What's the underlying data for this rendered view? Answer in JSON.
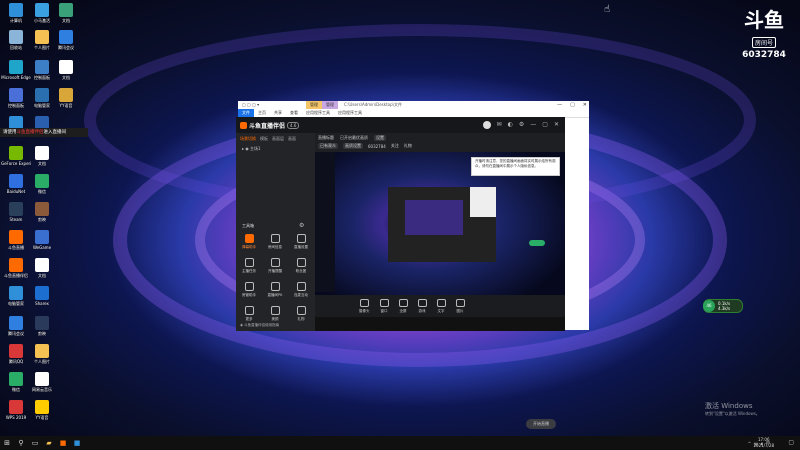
{
  "desktop": {
    "icons": [
      {
        "label": "计算机",
        "color": "#2f8fd8"
      },
      {
        "label": "小马激活",
        "color": "#3aa0e0"
      },
      {
        "label": "Microsoft Edge",
        "color": "#1fa5c9"
      },
      {
        "label": "回收站",
        "color": "#8ab4d8"
      },
      {
        "label": "控制面板",
        "color": "#3d7fc7"
      },
      {
        "label": "GeForce Experience",
        "color": "#76b900"
      },
      {
        "label": "BaiduNet",
        "color": "#2f6fe0"
      },
      {
        "label": "Steam",
        "color": "#2a3f5a"
      },
      {
        "label": "斗鱼直播",
        "color": "#ff6a00"
      },
      {
        "label": "斗鱼直播伴侣",
        "color": "#ff6a00"
      },
      {
        "label": "电脑管家",
        "color": "#2f8fd8"
      },
      {
        "label": "WeGame",
        "color": "#3a6fd0"
      },
      {
        "label": "腾讯QQ",
        "color": "#d93838"
      },
      {
        "label": "微信",
        "color": "#2aae67"
      },
      {
        "label": "WPS 2019",
        "color": "#d93838"
      },
      {
        "label": "YY语音",
        "color": "#ffcc00"
      },
      {
        "label": "剪映",
        "color": "#222222"
      },
      {
        "label": "Sharex",
        "color": "#1c6fd1"
      },
      {
        "label": "腾讯会议",
        "color": "#2f7fe0"
      },
      {
        "label": "个人图片",
        "color": "#f4c152"
      },
      {
        "label": "网易云音乐",
        "color": "#d33a31"
      },
      {
        "label": "文档",
        "color": "#ffffff"
      }
    ],
    "popup": {
      "prefix": "请使用",
      "highlight": "斗鱼直播伴侣",
      "suffix": "进入直播间"
    }
  },
  "room_logo": {
    "mark": "斗鱼",
    "tag": "房间号",
    "room_number": "6032784"
  },
  "explorer": {
    "tabs": [
      "管理",
      "管理"
    ],
    "path": "C:\\Users\\Admin\\Desktop\\文件",
    "ribbon": [
      "文件",
      "主页",
      "共享",
      "查看",
      "应用程序工具",
      "应用程序工具"
    ]
  },
  "app": {
    "brand": "斗鱼直播伴侣",
    "version": "4.6",
    "sidebar_tabs": [
      "场景切换",
      "模板",
      "画面层",
      "画面"
    ],
    "scene": "主场1",
    "toolbox_label": "工具箱",
    "tools": [
      {
        "label": "弹幕助手",
        "hot": true
      },
      {
        "label": "房间信息",
        "hot": false
      },
      {
        "label": "直播设置",
        "hot": false
      },
      {
        "label": "主播任务",
        "hot": false
      },
      {
        "label": "开播提醒",
        "hot": false
      },
      {
        "label": "粉丝团",
        "hot": false
      },
      {
        "label": "房管助手",
        "hot": false
      },
      {
        "label": "直播间PK",
        "hot": false
      },
      {
        "label": "连麦互动",
        "hot": false
      },
      {
        "label": "更多",
        "hot": false
      },
      {
        "label": "美颜",
        "hot": false
      },
      {
        "label": "礼物",
        "hot": false
      }
    ],
    "footer": "斗鱼直播伴侣使用指南",
    "main_row1": [
      "直播标题",
      "已开启最优画质",
      "设置"
    ],
    "main_row2": [
      "已有观众",
      "画质设置",
      "6032784",
      "关注",
      "礼物"
    ],
    "tooltip": "开播时请注意，您的直播间画面将实时展示给所有观众，请勿在直播间中展示个人隐私信息。",
    "controls": [
      "摄像头",
      "窗口",
      "全屏",
      "游戏",
      "文字",
      "图片"
    ],
    "start_label": "开始直播"
  },
  "watermark": {
    "line1": "激活 Windows",
    "line2": "转到\"设置\"以激活 Windows。"
  },
  "speed_widget": {
    "percent": "46",
    "up": "0.1k/s",
    "down": "4.3k/s"
  },
  "clock": {
    "time": "17:06",
    "date": "2021/7/28"
  }
}
